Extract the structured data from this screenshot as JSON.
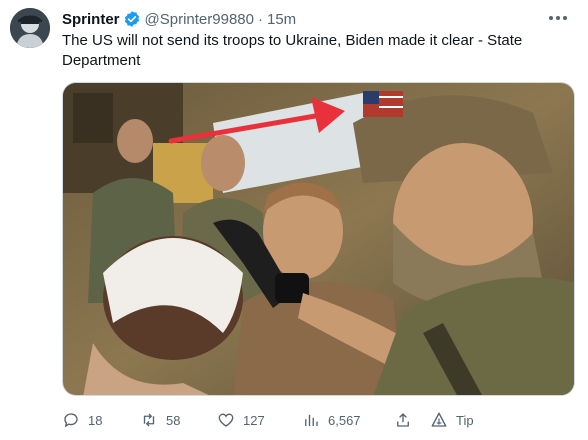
{
  "tweet": {
    "display_name": "Sprinter",
    "handle": "@Sprinter99880",
    "separator": "·",
    "time": "15m",
    "text": "The US will not send its troops to Ukraine, Biden made it clear - State Department",
    "verified": true
  },
  "media": {
    "description_icon": "photo"
  },
  "actions": {
    "replies": "18",
    "retweets": "58",
    "likes": "127",
    "views": "6,567",
    "tip_label": "Tip"
  },
  "colors": {
    "verified_blue": "#1d9bf0",
    "secondary_text": "#536471",
    "arrow_red": "#e8313b"
  }
}
